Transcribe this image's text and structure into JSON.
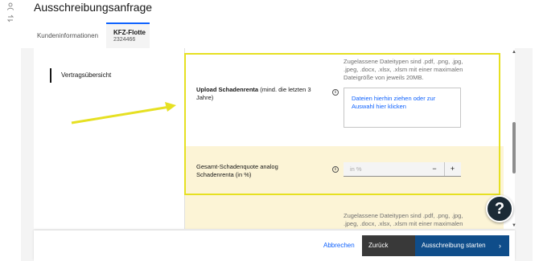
{
  "page": {
    "title": "Ausschreibungsanfrage"
  },
  "rail": {
    "icons": [
      "user-icon",
      "transfer-icon"
    ]
  },
  "tabs": [
    {
      "label": "Kundeninformationen"
    },
    {
      "label": "KFZ-Flotte",
      "sublabel": "2324466",
      "active": true
    }
  ],
  "nav": {
    "items": [
      {
        "label": "Vertragsübersicht"
      }
    ]
  },
  "form": {
    "upload": {
      "label_bold": "Upload Schadenrenta",
      "label_rest": " (mind. die letzten 3 Jahre)",
      "hint": "Zugelassene Dateitypen sind .pdf, .png, .jpg, .jpeg, .docx, .xlsx, .xlsm mit einer maximalen Dateigröße von jeweils 20MB.",
      "dropzone_text": "Dateien hierhin ziehen oder zur Auswahl hier klicken"
    },
    "quote": {
      "label": "Gesamt-Schadenquote analog Schadenrenta (in %)",
      "placeholder": "in %",
      "minus": "−",
      "plus": "+"
    },
    "next_hint": "Zugelassene Dateitypen sind .pdf, .png, .jpg, .jpeg, .docx, .xlsx, .xlsm mit einer maximalen Dateigröße"
  },
  "help": {
    "label": "?"
  },
  "footer": {
    "cancel": "Abbrechen",
    "back": "Zurück",
    "start": "Ausschreibung starten",
    "start_chevron": "›"
  },
  "colors": {
    "accent": "#0f62fe",
    "highlight": "#e6e022",
    "row_bg": "#fcf4d6",
    "primary_button": "#0f4d8a"
  }
}
